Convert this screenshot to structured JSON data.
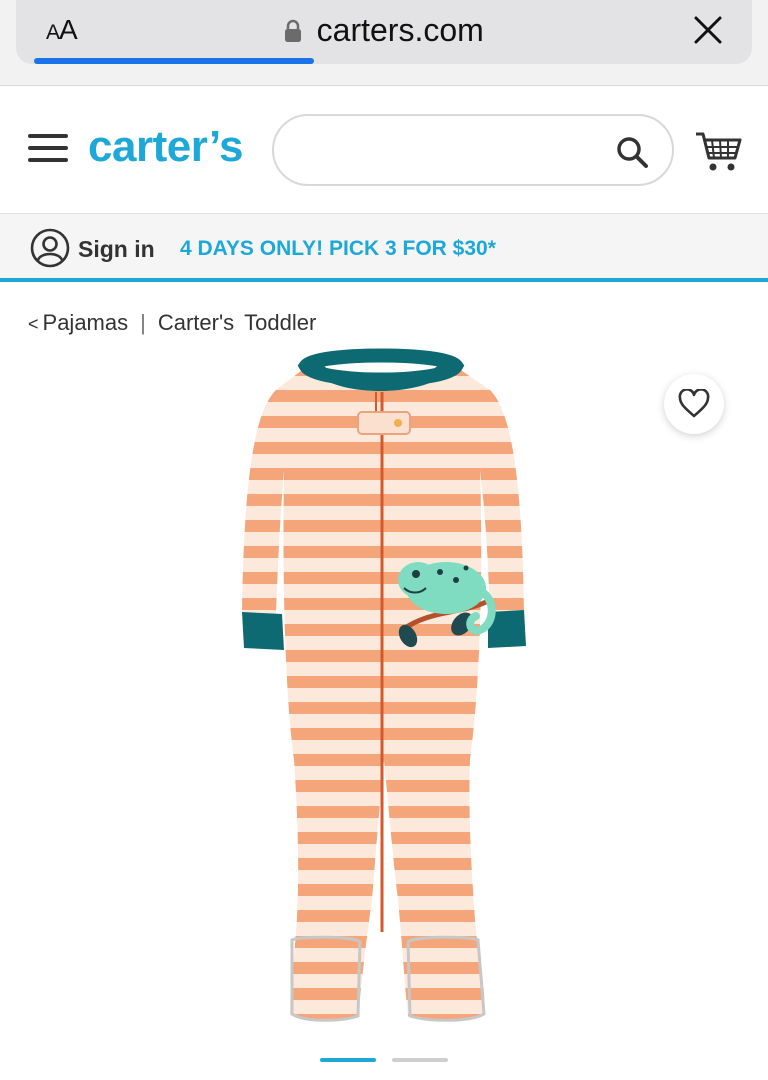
{
  "browser": {
    "aa_label_small": "A",
    "aa_label_large": "A",
    "url": "carters.com",
    "progress_fraction": 0.39
  },
  "header": {
    "logo_text": "carter’s",
    "search": {
      "value": "",
      "placeholder": ""
    }
  },
  "promo": {
    "signin_label": "Sign in",
    "message": "4 DAYS ONLY! PICK 3 FOR $30*"
  },
  "breadcrumb": {
    "back_chevron": "<",
    "items": [
      "Pajamas",
      "Carter's",
      "Toddler"
    ],
    "separator": "|"
  },
  "product": {
    "image_subject": "orange striped zip-up footed pajamas with chameleon appliqué",
    "image_index": 1,
    "image_count": 2
  },
  "colors": {
    "brand_blue": "#1ea8d8",
    "stripe_orange": "#f5a57a",
    "trim_teal": "#0e6a72",
    "chameleon_mint": "#7fdcc0"
  },
  "icons": [
    "aa-icon",
    "lock-icon",
    "close-icon",
    "hamburger-icon",
    "search-icon",
    "cart-icon",
    "user-icon",
    "heart-icon",
    "chevron-left-icon"
  ]
}
